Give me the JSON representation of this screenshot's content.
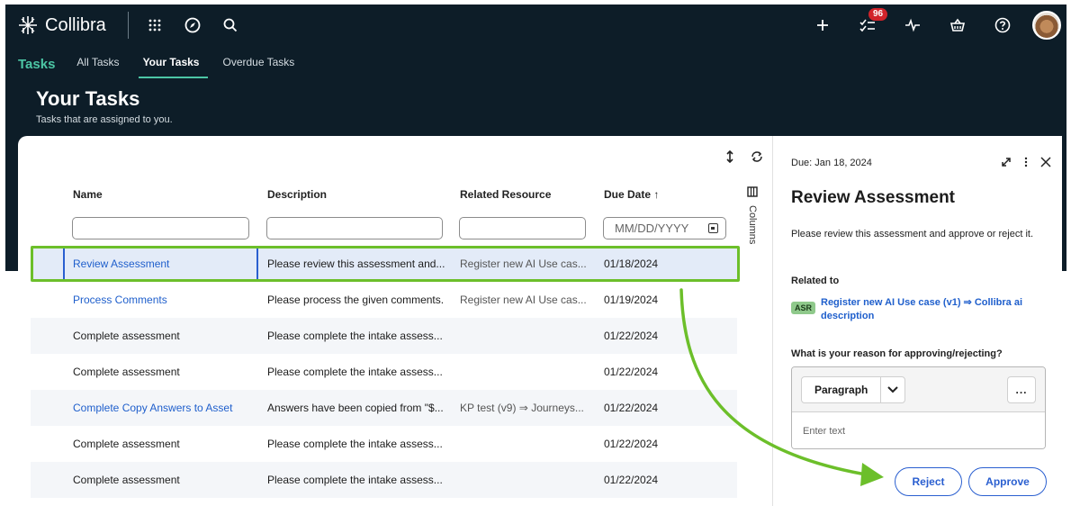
{
  "brand": {
    "name": "Collibra"
  },
  "topbar": {
    "notifications_count": "96"
  },
  "nav": {
    "section": "Tasks",
    "tabs": [
      {
        "label": "All Tasks",
        "active": false
      },
      {
        "label": "Your Tasks",
        "active": true
      },
      {
        "label": "Overdue Tasks",
        "active": false
      }
    ]
  },
  "page": {
    "title": "Your Tasks",
    "subtitle": "Tasks that are assigned to you."
  },
  "table": {
    "columns": [
      "Name",
      "Description",
      "Related Resource",
      "Due Date ↑"
    ],
    "date_placeholder": "MM/DD/YYYY",
    "columns_toggle": "Columns",
    "rows": [
      {
        "name": "Review Assessment",
        "description": "Please review this assessment and...",
        "resource": "Register new AI Use cas...",
        "due": "01/18/2024",
        "link": true,
        "selected": true
      },
      {
        "name": "Process Comments",
        "description": "Please process the given comments.",
        "resource": "Register new AI Use cas...",
        "due": "01/19/2024",
        "link": true,
        "selected": false
      },
      {
        "name": "Complete assessment",
        "description": "Please complete the intake assess...",
        "resource": "",
        "due": "01/22/2024",
        "link": false,
        "selected": false
      },
      {
        "name": "Complete assessment",
        "description": "Please complete the intake assess...",
        "resource": "",
        "due": "01/22/2024",
        "link": false,
        "selected": false
      },
      {
        "name": "Complete Copy Answers to Asset",
        "description": "Answers have been copied from \"$...",
        "resource": "KP test (v9) ⇒ Journeys...",
        "due": "01/22/2024",
        "link": true,
        "selected": false
      },
      {
        "name": "Complete assessment",
        "description": "Please complete the intake assess...",
        "resource": "",
        "due": "01/22/2024",
        "link": false,
        "selected": false
      },
      {
        "name": "Complete assessment",
        "description": "Please complete the intake assess...",
        "resource": "",
        "due": "01/22/2024",
        "link": false,
        "selected": false
      }
    ]
  },
  "panel": {
    "due": "Due: Jan 18, 2024",
    "title": "Review Assessment",
    "description": "Please review this assessment and approve or reject it.",
    "related_label": "Related to",
    "related_badge": "ASR",
    "related_link": "Register new AI Use case (v1) ⇒ Collibra ai description",
    "reason_label": "What is your reason for approving/rejecting?",
    "format": "Paragraph",
    "more": "...",
    "placeholder": "Enter text",
    "reject_label": "Reject",
    "approve_label": "Approve"
  },
  "colors": {
    "header_bg": "#0d1d28",
    "accent_green": "#4cc6a5",
    "link_blue": "#1f5fcc",
    "highlight_green": "#6cbf2a",
    "badge_red": "#d1232a"
  }
}
